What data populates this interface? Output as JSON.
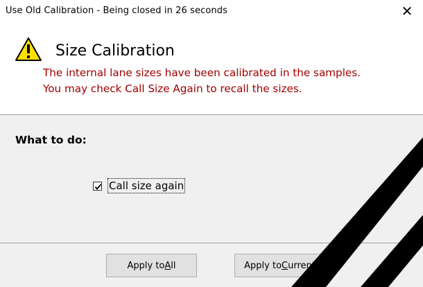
{
  "window": {
    "title": "Use Old Calibration - Being closed in 26 seconds",
    "close_glyph": "✕"
  },
  "header": {
    "icon": "warning-icon",
    "title": "Size Calibration",
    "message_line1": "The internal lane sizes have been calibrated in the samples.",
    "message_line2": "You may check Call Size Again to recall the sizes.",
    "message_color": "#a00000"
  },
  "options": {
    "label": "What to do:",
    "call_size_again": {
      "label": "Call size again",
      "checked": true
    }
  },
  "buttons": {
    "apply_all": {
      "pre": "Apply to ",
      "mnemonic": "A",
      "post": "ll"
    },
    "apply_current": {
      "pre": "Apply to ",
      "mnemonic": "C",
      "post": "urrent"
    }
  },
  "colors": {
    "panel_bg": "#f0f0f0",
    "button_bg": "#e1e1e1",
    "warning_fill": "#ffe000"
  }
}
